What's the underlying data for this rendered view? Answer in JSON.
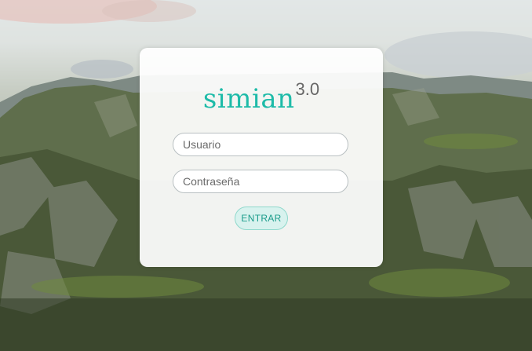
{
  "login": {
    "logo_name": "simian",
    "logo_version": "3.0",
    "username_placeholder": "Usuario",
    "password_placeholder": "Contraseña",
    "submit_label": "ENTRAR"
  },
  "colors": {
    "brand": "#1dbba8",
    "button_bg": "#d8f2ee",
    "button_border": "#8fd8cc"
  }
}
